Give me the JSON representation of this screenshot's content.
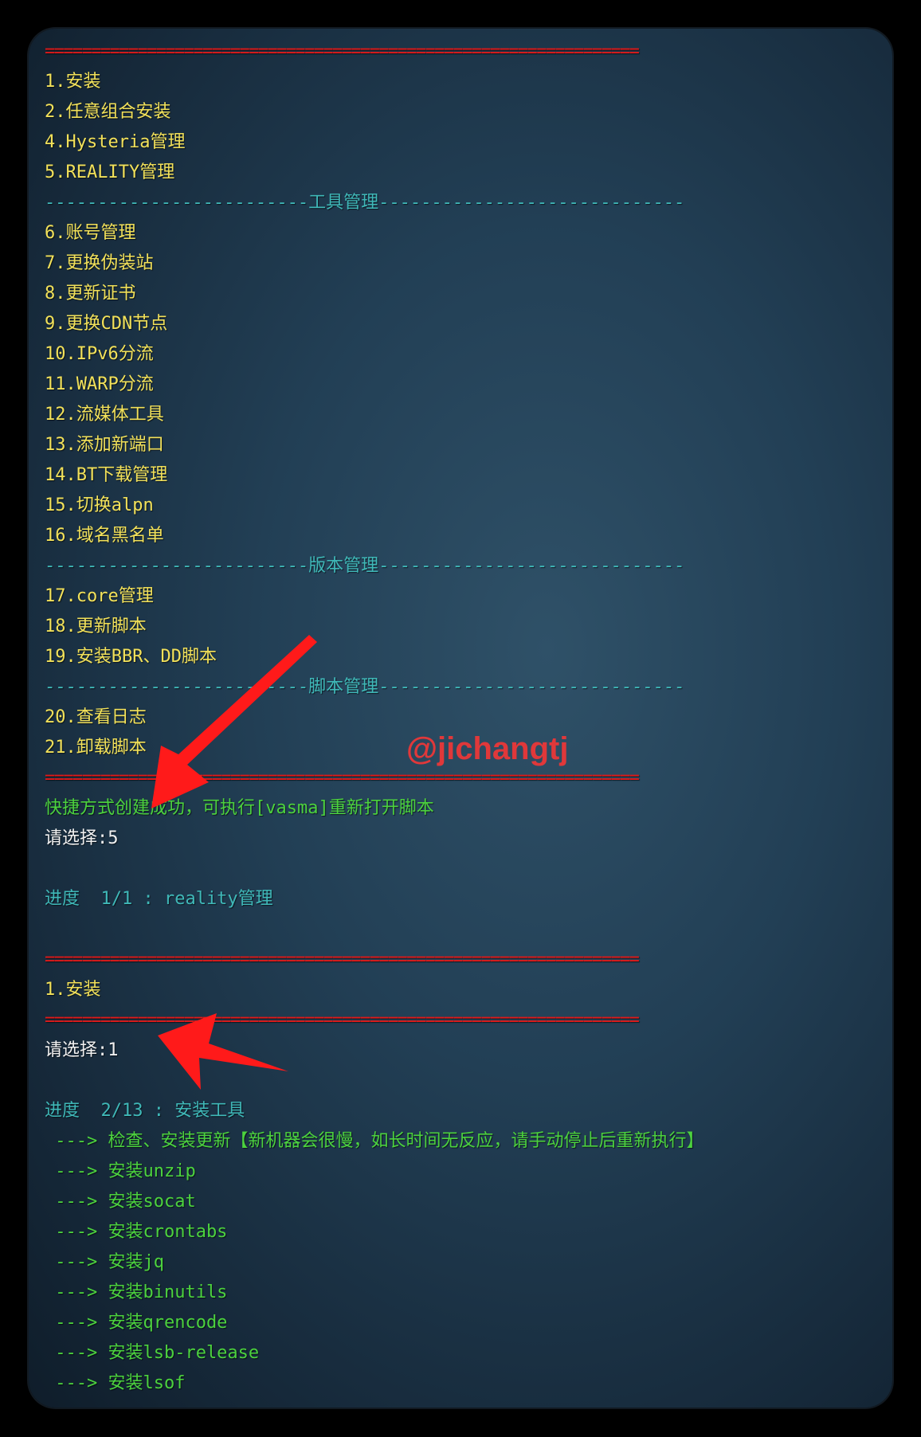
{
  "lines": [
    {
      "text": "================================================================",
      "color": "red"
    },
    {
      "text": "1.安装",
      "color": "yellow"
    },
    {
      "text": "2.任意组合安装",
      "color": "yellow"
    },
    {
      "text": "4.Hysteria管理",
      "color": "yellow"
    },
    {
      "text": "5.REALITY管理",
      "color": "yellow"
    },
    {
      "text": "-------------------------工具管理-----------------------------",
      "color": "cyan"
    },
    {
      "text": "6.账号管理",
      "color": "yellow"
    },
    {
      "text": "7.更换伪装站",
      "color": "yellow"
    },
    {
      "text": "8.更新证书",
      "color": "yellow"
    },
    {
      "text": "9.更换CDN节点",
      "color": "yellow"
    },
    {
      "text": "10.IPv6分流",
      "color": "yellow"
    },
    {
      "text": "11.WARP分流",
      "color": "yellow"
    },
    {
      "text": "12.流媒体工具",
      "color": "yellow"
    },
    {
      "text": "13.添加新端口",
      "color": "yellow"
    },
    {
      "text": "14.BT下载管理",
      "color": "yellow"
    },
    {
      "text": "15.切换alpn",
      "color": "yellow"
    },
    {
      "text": "16.域名黑名单",
      "color": "yellow"
    },
    {
      "text": "-------------------------版本管理-----------------------------",
      "color": "cyan"
    },
    {
      "text": "17.core管理",
      "color": "yellow"
    },
    {
      "text": "18.更新脚本",
      "color": "yellow"
    },
    {
      "text": "19.安装BBR、DD脚本",
      "color": "yellow"
    },
    {
      "text": "-------------------------脚本管理-----------------------------",
      "color": "cyan"
    },
    {
      "text": "20.查看日志",
      "color": "yellow"
    },
    {
      "text": "21.卸载脚本",
      "color": "yellow"
    },
    {
      "text": "================================================================",
      "color": "red"
    },
    {
      "text": "快捷方式创建成功，可执行[vasma]重新打开脚本",
      "color": "green"
    },
    {
      "text": "请选择:5",
      "color": "white"
    },
    {
      "text": "",
      "color": "white"
    },
    {
      "text": "进度  1/1 : reality管理",
      "color": "cyan"
    },
    {
      "text": "",
      "color": "white"
    },
    {
      "text": "================================================================",
      "color": "red"
    },
    {
      "text": "1.安装",
      "color": "yellow"
    },
    {
      "text": "================================================================",
      "color": "red"
    },
    {
      "text": "请选择:1",
      "color": "white"
    },
    {
      "text": "",
      "color": "white"
    },
    {
      "text": "进度  2/13 : 安装工具",
      "color": "cyan"
    },
    {
      "text": " ---> 检查、安装更新【新机器会很慢，如长时间无反应，请手动停止后重新执行】",
      "color": "green"
    },
    {
      "text": " ---> 安装unzip",
      "color": "green"
    },
    {
      "text": " ---> 安装socat",
      "color": "green"
    },
    {
      "text": " ---> 安装crontabs",
      "color": "green"
    },
    {
      "text": " ---> 安装jq",
      "color": "green"
    },
    {
      "text": " ---> 安装binutils",
      "color": "green"
    },
    {
      "text": " ---> 安装qrencode",
      "color": "green"
    },
    {
      "text": " ---> 安装lsb-release",
      "color": "green"
    },
    {
      "text": " ---> 安装lsof",
      "color": "green"
    }
  ],
  "watermark": "@jichangtj",
  "colors": {
    "yellow": "#f2e15a",
    "red": "#e01a1a",
    "cyan": "#3fb8b8",
    "green": "#4cd23e",
    "white": "#f1f1f1",
    "arrow": "#ff1a1a"
  }
}
